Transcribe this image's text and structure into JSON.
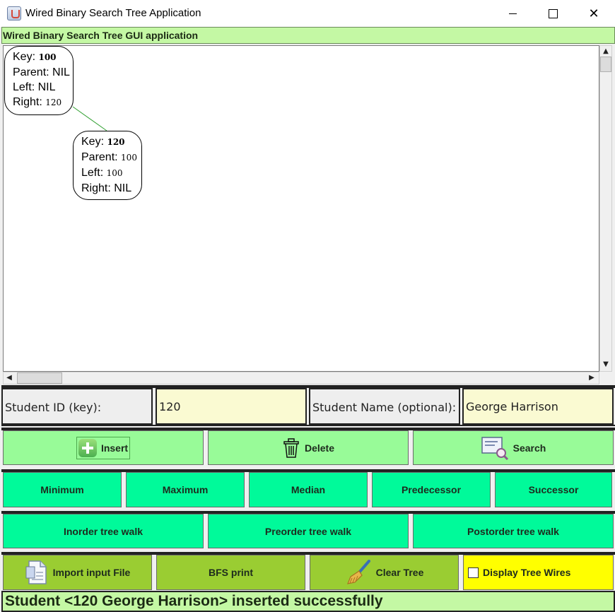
{
  "window": {
    "title": "Wired Binary Search Tree Application",
    "close_glyph": "✕"
  },
  "header": {
    "title": "Wired Binary Search Tree GUI application"
  },
  "tree": {
    "wire_color": "#2e9e2e",
    "nodes": [
      {
        "key": "100",
        "parent": "NIL",
        "left": "NIL",
        "right": "120"
      },
      {
        "key": "120",
        "parent": "100",
        "left": "100",
        "right": "NIL"
      }
    ],
    "labels": {
      "key": "Key:",
      "parent": "Parent:",
      "left": "Left:",
      "right": "Right:"
    }
  },
  "inputs": {
    "student_id_label": "Student ID (key):",
    "student_id_value": "120",
    "student_name_label": "Student Name (optional):",
    "student_name_value": "George Harrison"
  },
  "buttons": {
    "insert": "Insert",
    "delete": "Delete",
    "search": "Search",
    "minimum": "Minimum",
    "maximum": "Maximum",
    "median": "Median",
    "predecessor": "Predecessor",
    "successor": "Successor",
    "inorder": "Inorder tree walk",
    "preorder": "Preorder tree walk",
    "postorder": "Postorder tree walk",
    "import": "Import input File",
    "bfs": "BFS print",
    "clear": "Clear Tree",
    "display_wires": "Display Tree Wires"
  },
  "display_wires_checked": false,
  "status": "Student <120 George Harrison> inserted successfully",
  "colors": {
    "header_bg": "#c4f8a4",
    "row1_bg": "#98fb98",
    "row2_bg": "#00fa9a",
    "row4_bg": "#9acd32",
    "wires_bg": "#ffff00",
    "input_bg": "#fafad2"
  }
}
